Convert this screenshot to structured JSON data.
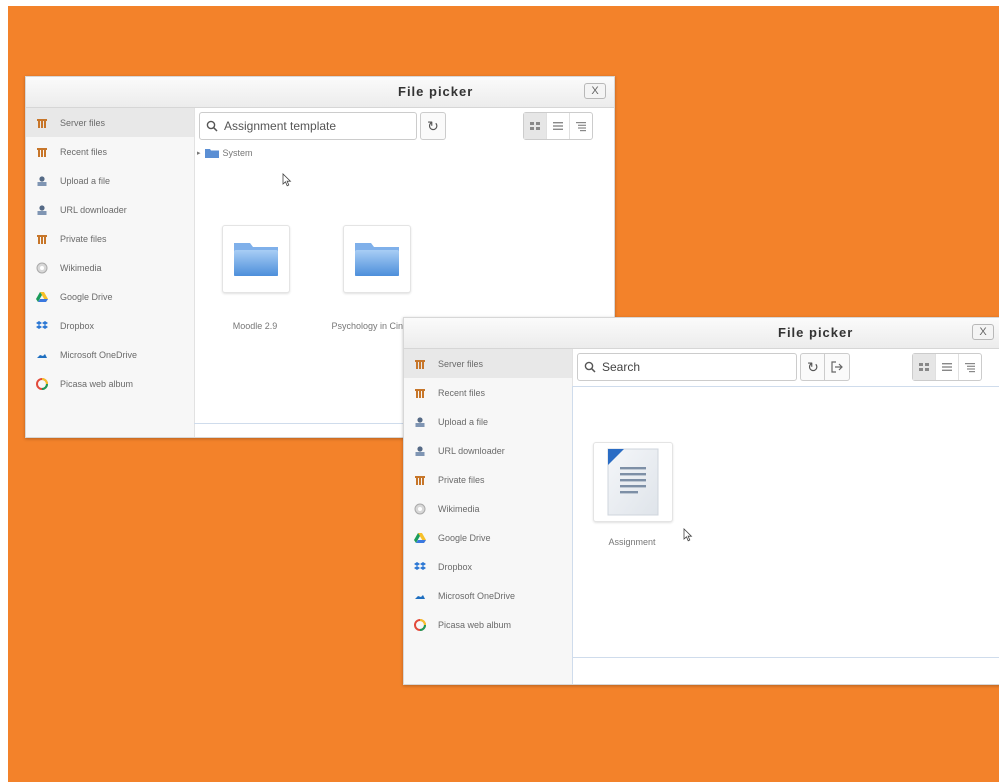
{
  "background_color": "#f3822a",
  "windows": [
    {
      "title": "File picker",
      "close_label": "X",
      "sidebar": [
        {
          "label": "Server files",
          "icon": "server-files-icon",
          "active": true
        },
        {
          "label": "Recent files",
          "icon": "recent-files-icon"
        },
        {
          "label": "Upload a file",
          "icon": "upload-icon"
        },
        {
          "label": "URL downloader",
          "icon": "url-downloader-icon"
        },
        {
          "label": "Private files",
          "icon": "private-files-icon"
        },
        {
          "label": "Wikimedia",
          "icon": "wikimedia-icon"
        },
        {
          "label": "Google Drive",
          "icon": "google-drive-icon"
        },
        {
          "label": "Dropbox",
          "icon": "dropbox-icon"
        },
        {
          "label": "Microsoft OneDrive",
          "icon": "onedrive-icon"
        },
        {
          "label": "Picasa web album",
          "icon": "picasa-icon"
        }
      ],
      "search_value": "Assignment template",
      "breadcrumb": "System",
      "items": [
        {
          "label": "Moodle 2.9",
          "icon": "folder-icon"
        },
        {
          "label": "Psychology in Cinema",
          "icon": "folder-icon"
        }
      ]
    },
    {
      "title": "File picker",
      "close_label": "X",
      "sidebar": [
        {
          "label": "Server files",
          "icon": "server-files-icon",
          "active": true
        },
        {
          "label": "Recent files",
          "icon": "recent-files-icon"
        },
        {
          "label": "Upload a file",
          "icon": "upload-icon"
        },
        {
          "label": "URL downloader",
          "icon": "url-downloader-icon"
        },
        {
          "label": "Private files",
          "icon": "private-files-icon"
        },
        {
          "label": "Wikimedia",
          "icon": "wikimedia-icon"
        },
        {
          "label": "Google Drive",
          "icon": "google-drive-icon"
        },
        {
          "label": "Dropbox",
          "icon": "dropbox-icon"
        },
        {
          "label": "Microsoft OneDrive",
          "icon": "onedrive-icon"
        },
        {
          "label": "Picasa web album",
          "icon": "picasa-icon"
        }
      ],
      "search_placeholder": "Search",
      "items": [
        {
          "label": "Assignment",
          "icon": "document-icon"
        }
      ]
    }
  ]
}
